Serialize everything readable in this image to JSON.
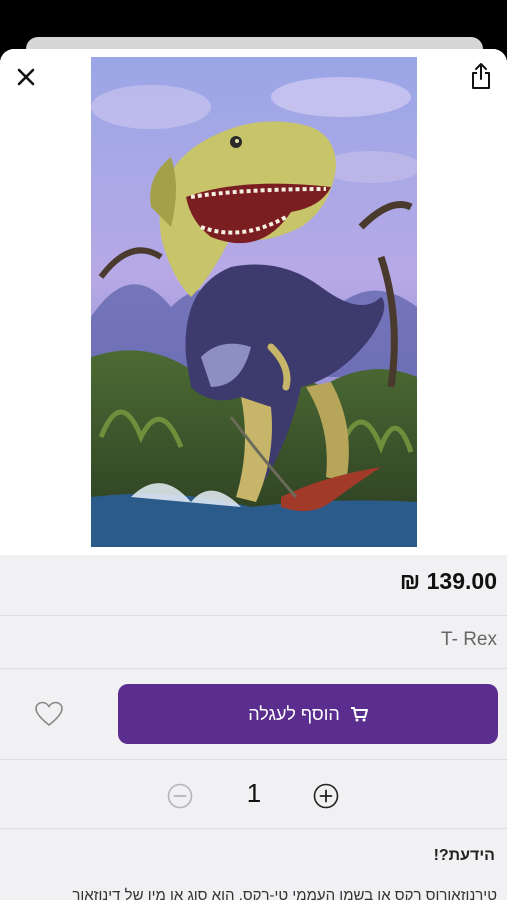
{
  "header": {
    "close_icon": "close-icon",
    "share_icon": "share-icon"
  },
  "product": {
    "image_alt": "T-Rex puzzle illustration",
    "price": "₪ 139.00",
    "name": "T- Rex"
  },
  "actions": {
    "add_to_cart_label": "הוסף לעגלה",
    "cart_icon": "cart-icon",
    "wishlist_icon": "heart-icon"
  },
  "quantity": {
    "value": "1",
    "minus_icon": "minus-circle-icon",
    "plus_icon": "plus-circle-icon"
  },
  "info": {
    "heading": "הידעת?!",
    "text": "טירנוזאורוס רקס או בשמו העממי טי-רקס, הוא סוג או מין של דינוזאור"
  },
  "colors": {
    "accent": "#5b2d8e",
    "background": "#f1f1f3"
  }
}
